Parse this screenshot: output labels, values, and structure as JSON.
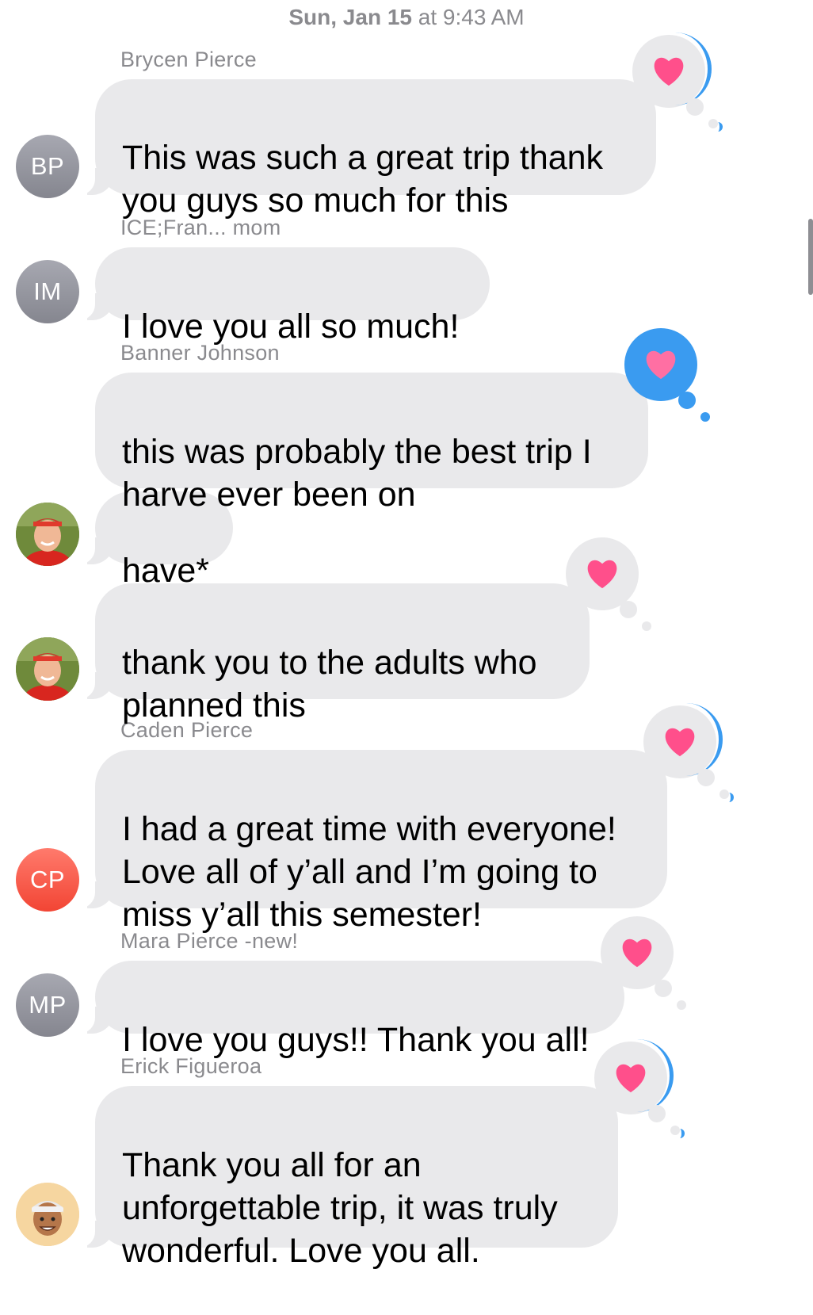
{
  "timestamp": {
    "day": "Sun, Jan 15",
    "time": " at 9:43 AM"
  },
  "colors": {
    "bubble": "#e9e9eb",
    "heart": "#ff4f8b",
    "tapback_blue": "#3a9bf0",
    "secondary_text": "#8a8a8e"
  },
  "messages": [
    {
      "sender": "Brycen Pierce",
      "avatar": "BP",
      "text": "This was such a great trip thank\nyou guys so much for this",
      "reaction": "heart"
    },
    {
      "sender": "ICE;Fran... mom",
      "avatar": "IM",
      "text": "I love you all so much!",
      "reaction": ""
    },
    {
      "sender": "Banner Johnson",
      "avatar": "photo",
      "text": "this was probably the best trip I\nharve ever been on",
      "reaction": "heart-mine"
    },
    {
      "sender": "",
      "avatar": "photo",
      "text": "have*",
      "reaction": ""
    },
    {
      "sender": "",
      "avatar": "photo",
      "text": "thank you to the adults who\nplanned this",
      "reaction": "heart"
    },
    {
      "sender": "Caden Pierce",
      "avatar": "CP",
      "text": "I had a great time with everyone!\nLove all of y’all and I’m going to\nmiss y’all this semester!",
      "reaction": "heart"
    },
    {
      "sender": "Mara Pierce -new!",
      "avatar": "MP",
      "text": "I love you guys!! Thank you all!",
      "reaction": "heart"
    },
    {
      "sender": "Erick Figueroa",
      "avatar": "memoji",
      "text": "Thank you all for an\nunforgettable trip, it was truly\nwonderful.  Love you all.",
      "reaction": "heart"
    }
  ]
}
